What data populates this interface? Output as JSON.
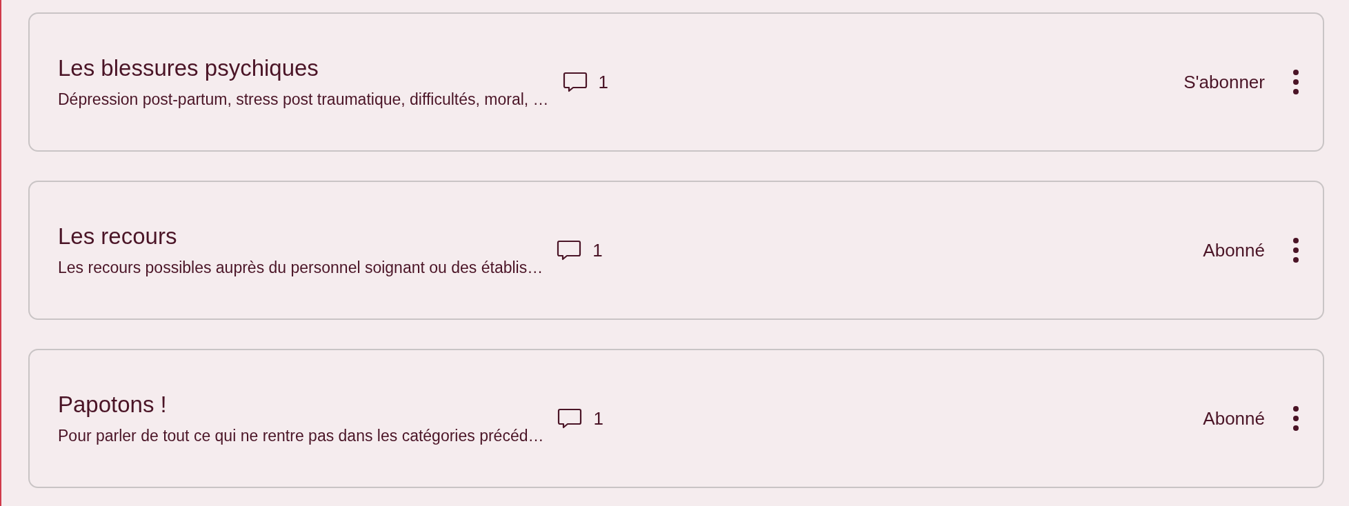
{
  "categories": [
    {
      "title": "Les blessures psychiques",
      "description": "Dépression post-partum, stress post traumatique, difficultés, moral, …",
      "comments": "1",
      "subscribe": "S'abonner"
    },
    {
      "title": "Les recours",
      "description": "Les recours possibles auprès du personnel soignant ou des établis…",
      "comments": "1",
      "subscribe": "Abonné"
    },
    {
      "title": "Papotons !",
      "description": "Pour parler de tout ce qui ne rentre pas dans les catégories précéd…",
      "comments": "1",
      "subscribe": "Abonné"
    }
  ]
}
